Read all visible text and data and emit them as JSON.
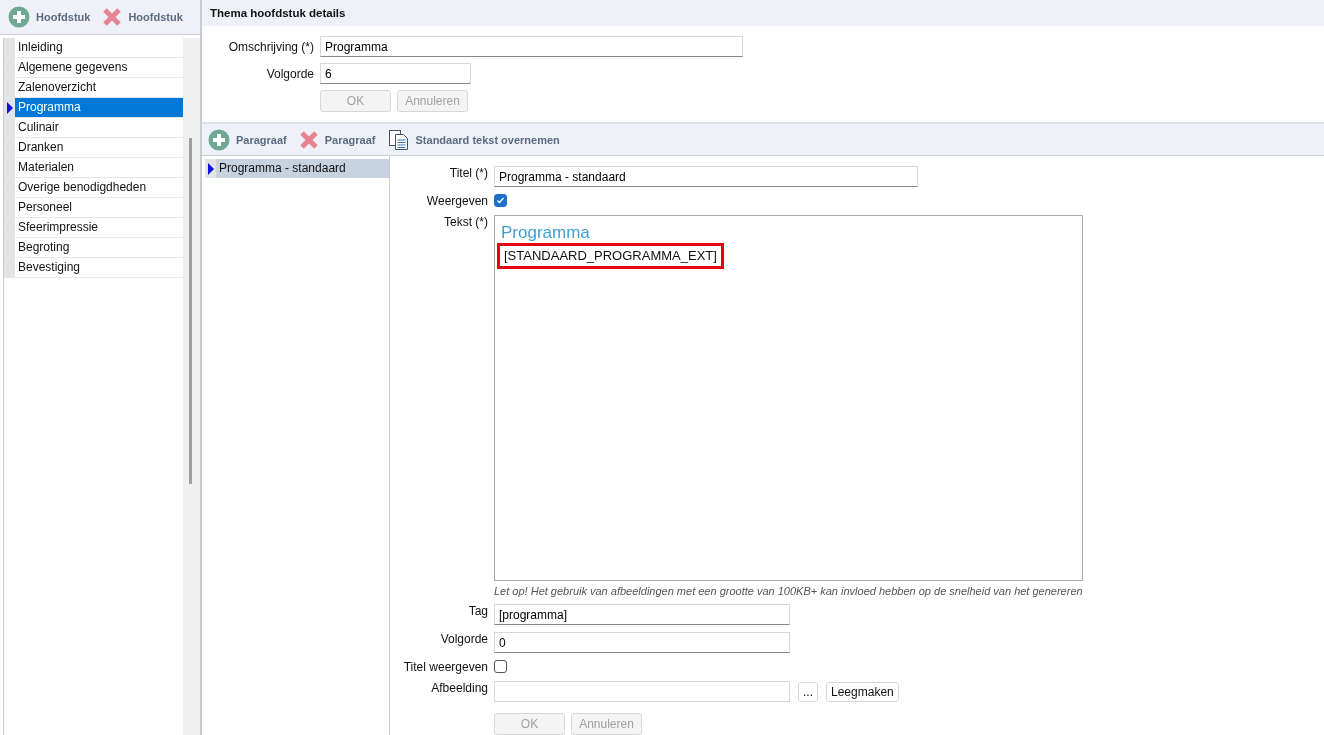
{
  "chapter_toolbar": {
    "buttons": [
      {
        "kind": "add",
        "label": "Hoofdstuk"
      },
      {
        "kind": "delete",
        "label": "Hoofdstuk"
      }
    ]
  },
  "chapters": [
    {
      "label": "Inleiding",
      "selected": false
    },
    {
      "label": "Algemene gegevens",
      "selected": false
    },
    {
      "label": "Zalenoverzicht",
      "selected": false
    },
    {
      "label": "Programma",
      "selected": true
    },
    {
      "label": "Culinair",
      "selected": false
    },
    {
      "label": "Dranken",
      "selected": false
    },
    {
      "label": "Materialen",
      "selected": false
    },
    {
      "label": "Overige benodigdheden",
      "selected": false
    },
    {
      "label": "Personeel",
      "selected": false
    },
    {
      "label": "Sfeerimpressie",
      "selected": false
    },
    {
      "label": "Begroting",
      "selected": false
    },
    {
      "label": "Bevestiging",
      "selected": false
    }
  ],
  "details": {
    "title": "Thema hoofdstuk details",
    "fields": [
      {
        "kind": "wide",
        "label": "Omschrijving (*)",
        "value": "Programma"
      },
      {
        "kind": "short",
        "label": "Volgorde",
        "value": "6"
      }
    ],
    "buttons": [
      {
        "label": "OK",
        "disabled": true
      },
      {
        "label": "Annuleren",
        "disabled": true
      }
    ]
  },
  "paragraph_toolbar": {
    "buttons": [
      {
        "kind": "add",
        "label": "Paragraaf"
      },
      {
        "kind": "delete",
        "label": "Paragraaf"
      },
      {
        "kind": "copy",
        "label": "Standaard tekst overnemen"
      }
    ]
  },
  "paragraphs": [
    {
      "label": "Programma - standaard",
      "selected": true
    }
  ],
  "paragraph_form": [
    {
      "kind": "wide_text",
      "label": "Titel (*)",
      "value": "Programma - standaard"
    },
    {
      "kind": "checkbox",
      "label": "Weergeven",
      "checked": true
    },
    {
      "kind": "editor",
      "label": "Tekst (*)",
      "heading": "Programma",
      "body": "[STANDAARD_PROGRAMMA_EXT]",
      "highlighted": true
    },
    {
      "kind": "note",
      "text": "Let op! Het gebruik van afbeeldingen met een grootte van 100KB+ kan invloed hebben op de snelheid van het genereren"
    },
    {
      "kind": "text",
      "label": "Tag",
      "value": "[programma]"
    },
    {
      "kind": "text",
      "label": "Volgorde",
      "value": "0"
    },
    {
      "kind": "checkbox",
      "label": "Titel weergeven",
      "checked": false
    },
    {
      "kind": "file",
      "label": "Afbeelding",
      "browse": "...",
      "clear": "Leegmaken"
    },
    {
      "kind": "buttons",
      "buttons": [
        {
          "label": "OK",
          "disabled": true
        },
        {
          "label": "Annuleren",
          "disabled": true
        }
      ]
    }
  ]
}
